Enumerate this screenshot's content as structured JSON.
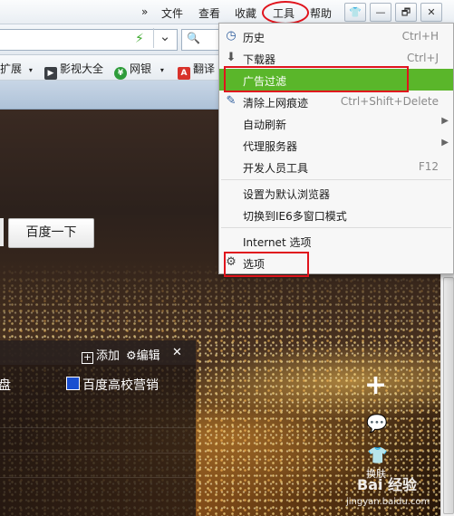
{
  "menubar": {
    "overflow": "»",
    "file": "文件",
    "view": "查看",
    "favorites": "收藏",
    "tools": "工具",
    "help": "帮助",
    "win_skin": "👕",
    "win_min": "—",
    "win_restore": "🗗",
    "win_close": "✕"
  },
  "address": {
    "go_icon": "⚡",
    "dropdown_icon": "⌄",
    "search_icon": "🔍"
  },
  "favorites_bar": {
    "items": [
      {
        "label": "扩展",
        "icon": "puzzle-icon"
      },
      {
        "label": "影视大全",
        "icon": "video-icon"
      },
      {
        "label": "网银",
        "icon": "bank-icon"
      },
      {
        "label": "翻译",
        "icon": "translate-icon"
      }
    ]
  },
  "page": {
    "search_button": "百度一下",
    "nav_panel": {
      "add": "添加",
      "edit": "编辑",
      "close": "✕",
      "links": [
        "盘",
        "百度高校营销"
      ]
    },
    "right_icons": {
      "plus": "+",
      "chat": "💬",
      "skin_label": "换肤"
    },
    "watermark_text": "Bai 经验",
    "watermark_url": "jingyan.baidu.com"
  },
  "tools_menu": {
    "items": [
      {
        "label": "历史",
        "shortcut": "Ctrl+H",
        "icon": "clock-icon"
      },
      {
        "label": "下载器",
        "shortcut": "Ctrl+J",
        "icon": "download-icon"
      },
      {
        "label": "广告过滤",
        "shortcut": "",
        "icon": ""
      },
      {
        "label": "清除上网痕迹",
        "shortcut": "Ctrl+Shift+Delete",
        "icon": "eraser-icon"
      },
      {
        "label": "自动刷新",
        "shortcut": "",
        "icon": ""
      },
      {
        "label": "代理服务器",
        "shortcut": "",
        "icon": ""
      },
      {
        "label": "开发人员工具",
        "shortcut": "F12",
        "icon": ""
      },
      {
        "label": "设置为默认浏览器",
        "shortcut": "",
        "icon": ""
      },
      {
        "label": "切换到IE6多窗口模式",
        "shortcut": "",
        "icon": ""
      },
      {
        "label": "Internet 选项",
        "shortcut": "",
        "icon": ""
      },
      {
        "label": "选项",
        "shortcut": "",
        "icon": "gear-icon"
      }
    ],
    "submenu_arrow": "▶"
  },
  "colors": {
    "highlight_green": "#5ab62a",
    "annotation_red": "#e0141d"
  }
}
